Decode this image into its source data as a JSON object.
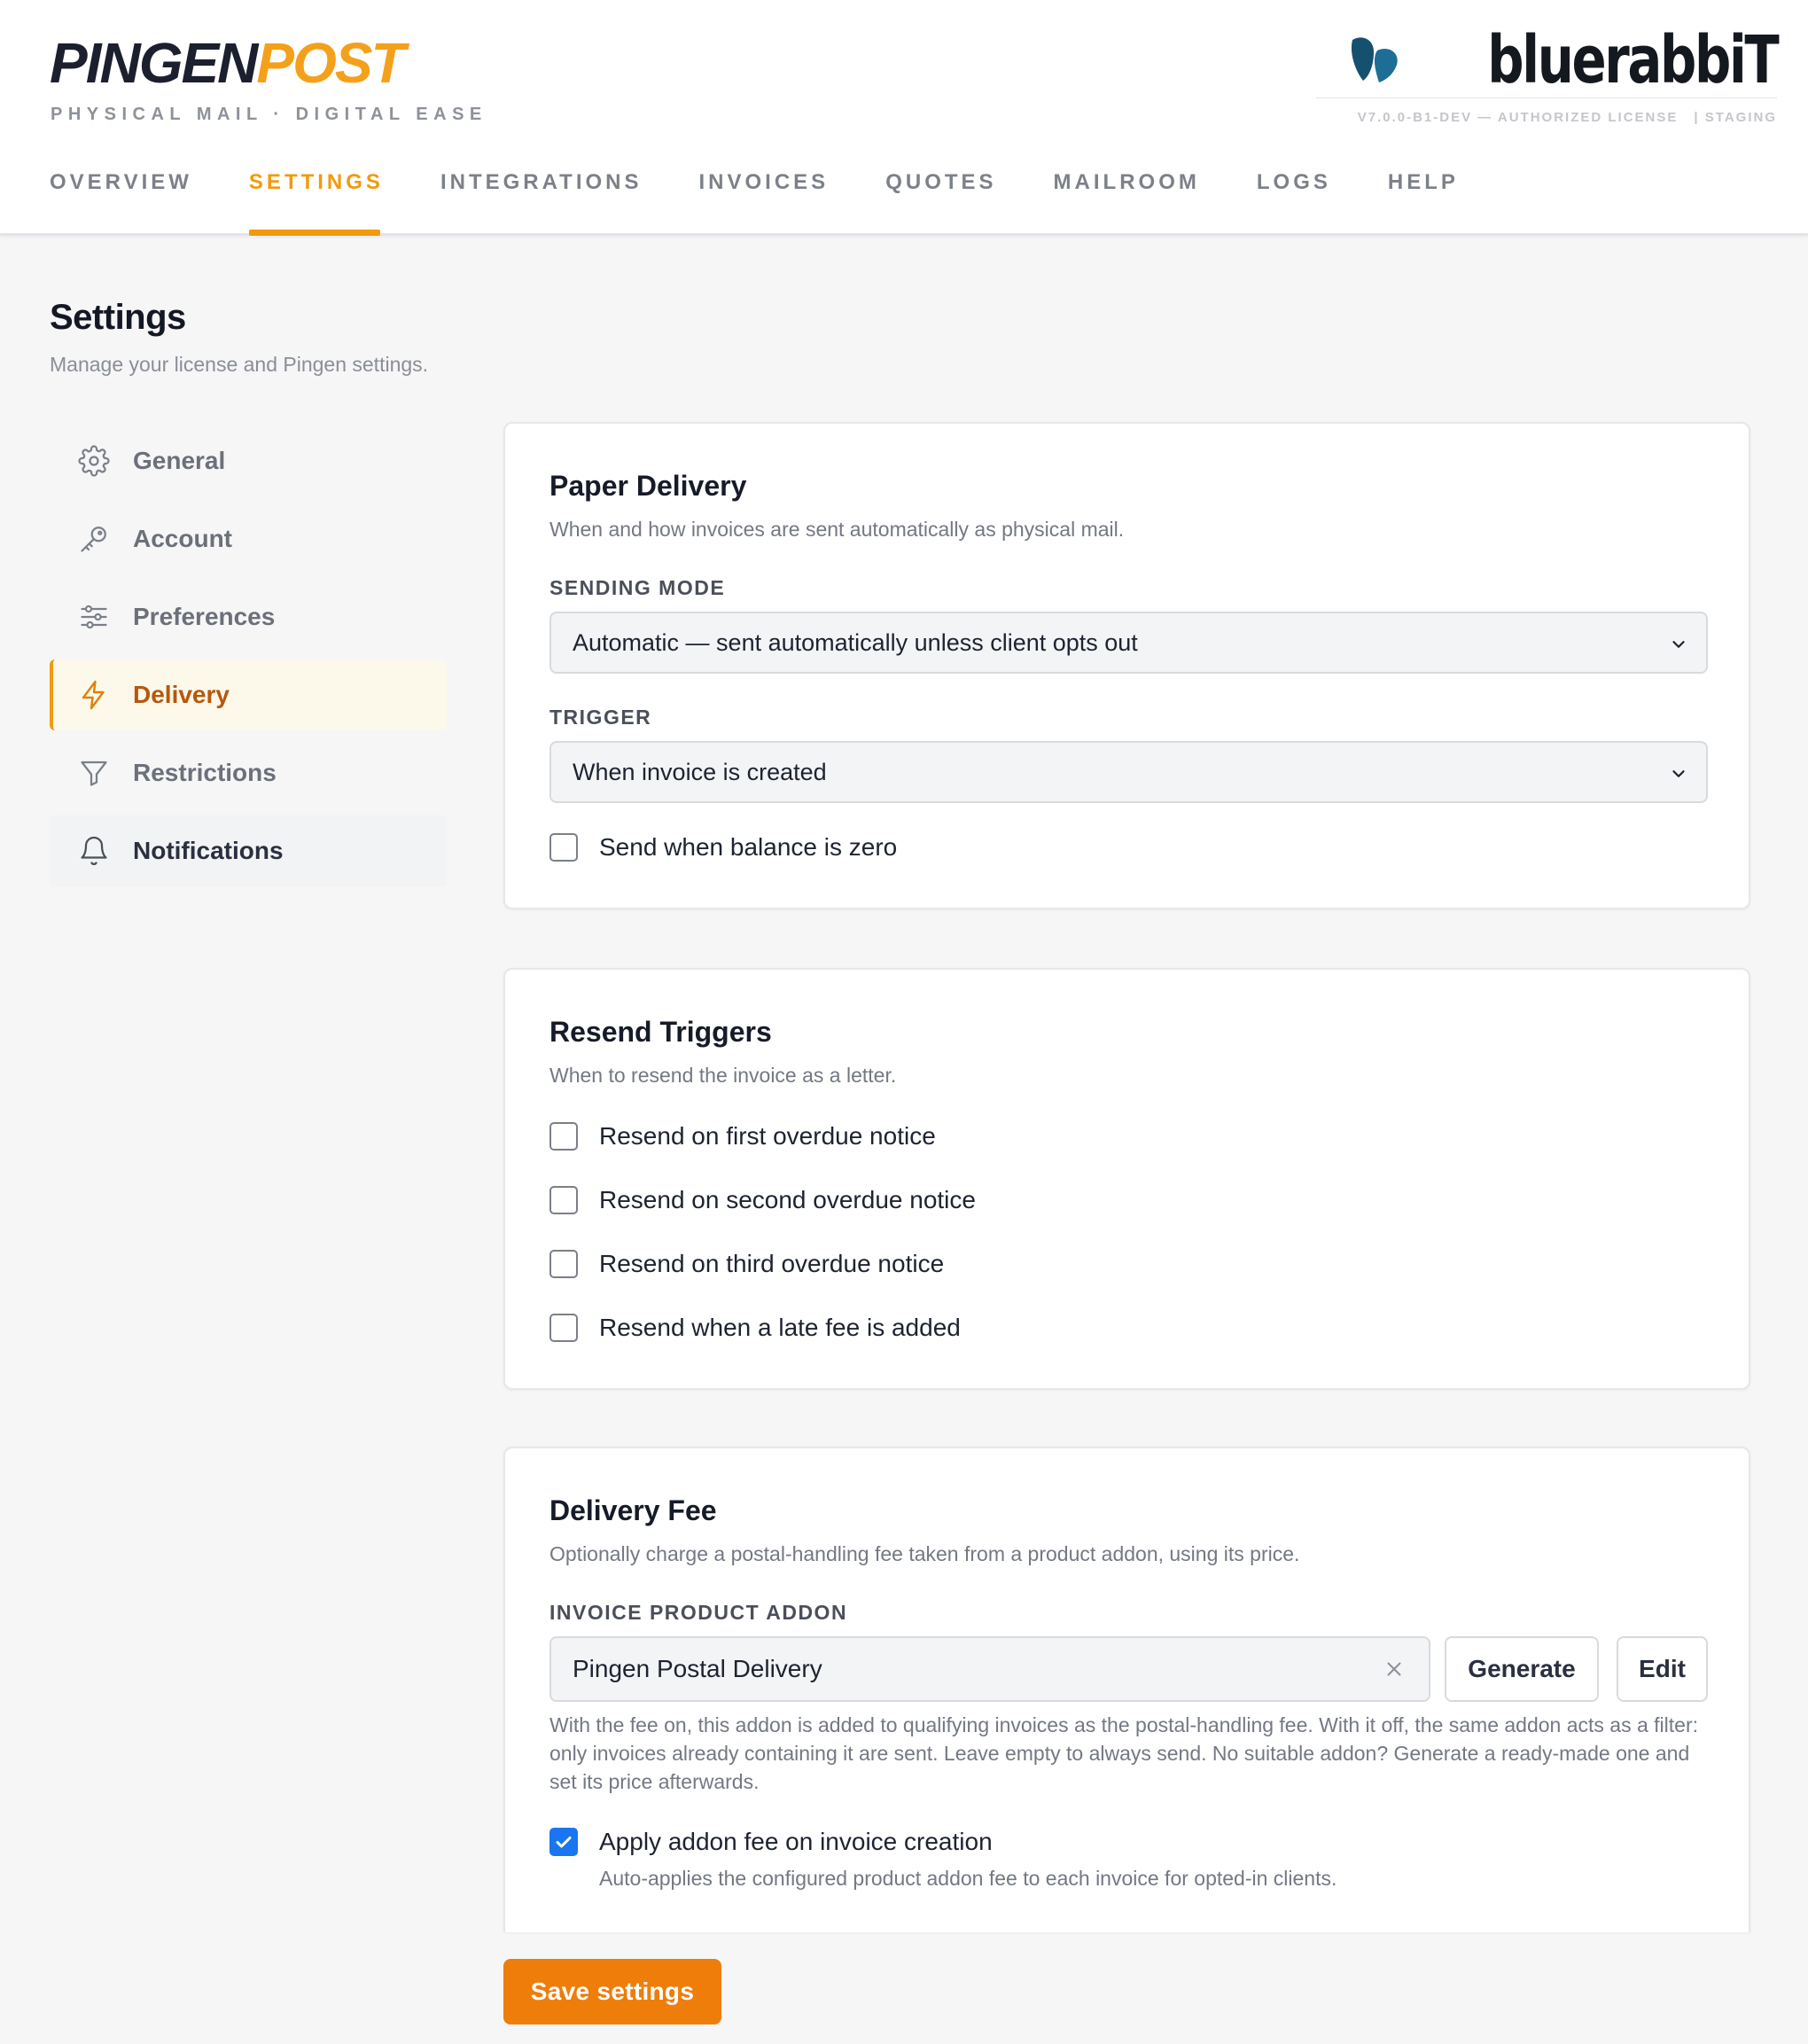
{
  "header": {
    "logo_part1": "PINGEN",
    "logo_part2": "POST",
    "tagline": "PHYSICAL MAIL · DIGITAL EASE",
    "brand": "bluerabbiT",
    "version": "V7.0.0-B1-DEV — AUTHORIZED LICENSE",
    "environment": "| STAGING",
    "accent_color": "#f29a0c"
  },
  "nav": {
    "items": [
      {
        "label": "OVERVIEW"
      },
      {
        "label": "SETTINGS"
      },
      {
        "label": "INTEGRATIONS"
      },
      {
        "label": "INVOICES"
      },
      {
        "label": "QUOTES"
      },
      {
        "label": "MAILROOM"
      },
      {
        "label": "LOGS"
      },
      {
        "label": "HELP"
      }
    ],
    "active": "SETTINGS"
  },
  "page": {
    "title": "Settings",
    "subtitle": "Manage your license and Pingen settings."
  },
  "sidebar": {
    "items": [
      {
        "label": "General",
        "icon": "gear-icon"
      },
      {
        "label": "Account",
        "icon": "key-icon"
      },
      {
        "label": "Preferences",
        "icon": "sliders-icon"
      },
      {
        "label": "Delivery",
        "icon": "lightning-icon"
      },
      {
        "label": "Restrictions",
        "icon": "funnel-icon"
      },
      {
        "label": "Notifications",
        "icon": "bell-icon"
      }
    ],
    "active": "Delivery"
  },
  "paper_delivery": {
    "title": "Paper Delivery",
    "description": "When and how invoices are sent automatically as physical mail.",
    "sending_mode_label": "SENDING MODE",
    "sending_mode_value": "Automatic — sent automatically unless client opts out",
    "trigger_label": "TRIGGER",
    "trigger_value": "When invoice is created",
    "balance_zero_label": "Send when balance is zero",
    "balance_zero_checked": false
  },
  "resend_triggers": {
    "title": "Resend Triggers",
    "description": "When to resend the invoice as a letter.",
    "options": [
      {
        "label": "Resend on first overdue notice",
        "checked": false
      },
      {
        "label": "Resend on second overdue notice",
        "checked": false
      },
      {
        "label": "Resend on third overdue notice",
        "checked": false
      },
      {
        "label": "Resend when a late fee is added",
        "checked": false
      }
    ]
  },
  "delivery_fee": {
    "title": "Delivery Fee",
    "description": "Optionally charge a postal-handling fee taken from a product addon, using its price.",
    "addon_label": "INVOICE PRODUCT ADDON",
    "addon_value": "Pingen Postal Delivery",
    "generate_label": "Generate",
    "edit_label": "Edit",
    "help_text": "With the fee on, this addon is added to qualifying invoices as the postal-handling fee. With it off, the same addon acts as a filter: only invoices already containing it are sent. Leave empty to always send. No suitable addon? Generate a ready-made one and set its price afterwards.",
    "apply_label": "Apply addon fee on invoice creation",
    "apply_checked": true,
    "apply_help": "Auto-applies the configured product addon fee to each invoice for opted-in clients."
  },
  "save_label": "Save settings"
}
